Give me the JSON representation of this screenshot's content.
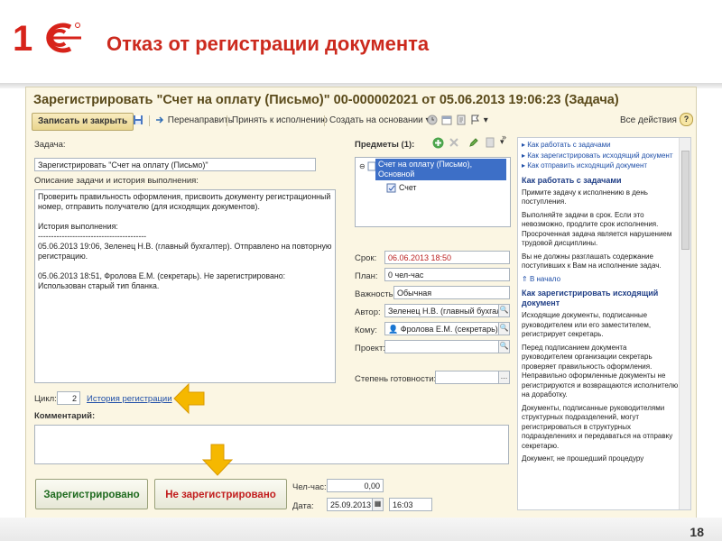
{
  "slide": {
    "title": "Отказ от регистрации документа",
    "page_number": "18",
    "logo_text": "1С"
  },
  "window": {
    "title": "Зарегистрировать \"Счет на оплату (Письмо)\" 00-000002021 от 05.06.2013 19:06:23 (Задача)"
  },
  "toolbar": {
    "save_close": "Записать и закрыть",
    "redirect": "Перенаправить",
    "accept": "Принять к исполнению",
    "create_based": "Создать на основании",
    "all_actions": "Все действия",
    "help": "?"
  },
  "left": {
    "task_label": "Задача:",
    "task_value": "Зарегистрировать \"Счет на оплату (Письмо)\"",
    "desc_label": "Описание задачи и история выполнения:",
    "desc_text": "Проверить правильность оформления, присвоить документу регистрационный номер, отправить получателю (для исходящих документов).\n\nИстория выполнения:\n-----------------------------------------\n05.06.2013 19:06, Зеленец Н.В. (главный бухгалтер). Отправлено на повторную регистрацию.\n\n05.06.2013 18:51, Фролова Е.М. (секретарь). Не зарегистрировано:\nИспользован старый тип бланка.",
    "cycle_label": "Цикл:",
    "cycle_value": "2",
    "history_link": "История регистрации",
    "comment_label": "Комментарий:"
  },
  "subjects": {
    "label": "Предметы (1):",
    "item": "Счет на оплату (Письмо), Основной",
    "child": "Счет"
  },
  "props": {
    "deadline_label": "Срок:",
    "deadline_value": "06.06.2013 18:50",
    "plan_label": "План:",
    "plan_value": "0 чел-час",
    "importance_label": "Важность:",
    "importance_value": "Обычная",
    "author_label": "Автор:",
    "author_value": "Зеленец Н.В. (главный бухгалт",
    "to_label": "Кому:",
    "to_value": "Фролова Е.М. (секретарь)",
    "project_label": "Проект:",
    "project_value": "",
    "readiness_label": "Степень готовности:",
    "readiness_value": ""
  },
  "bottom": {
    "registered_button": "Зарегистрировано",
    "not_registered_button": "Не зарегистрировано",
    "hours_label": "Чел-час:",
    "hours_value": "0,00",
    "date_label": "Дата:",
    "date_value": "25.09.2013",
    "time_value": "16:03"
  },
  "help": {
    "links": [
      "Как работать с задачами",
      "Как зарегистрировать исходящий документ",
      "Как отправить исходящий документ"
    ],
    "h1": "Как работать с задачами",
    "p1": "Примите задачу к исполнению в день поступления.",
    "p2": "Выполняйте задачи в срок. Если это невозможно, продлите срок исполнения. Просроченная задача является нарушением трудовой дисциплины.",
    "p3": "Вы не должны разглашать содержание поступивших к Вам на исполнение задач.",
    "to_start": "В начало",
    "h2": "Как зарегистрировать исходящий документ",
    "p4": "Исходящие документы, подписанные руководителем или его заместителем, регистрирует секретарь.",
    "p5": "Перед подписанием документа руководителем организации секретарь проверяет правильность оформления. Неправильно оформленные документы не регистрируются и возвращаются исполнителю на доработку.",
    "p6": "Документы, подписанные руководителями структурных подразделений, могут регистрироваться в структурных подразделениях и передаваться на отправку секретарю.",
    "p7": "Документ, не прошедший процедуру"
  },
  "colors": {
    "title_red": "#cc2a1e",
    "arrow": "#f5b800",
    "selection": "#3d6fc7",
    "link": "#1f4fa8"
  }
}
